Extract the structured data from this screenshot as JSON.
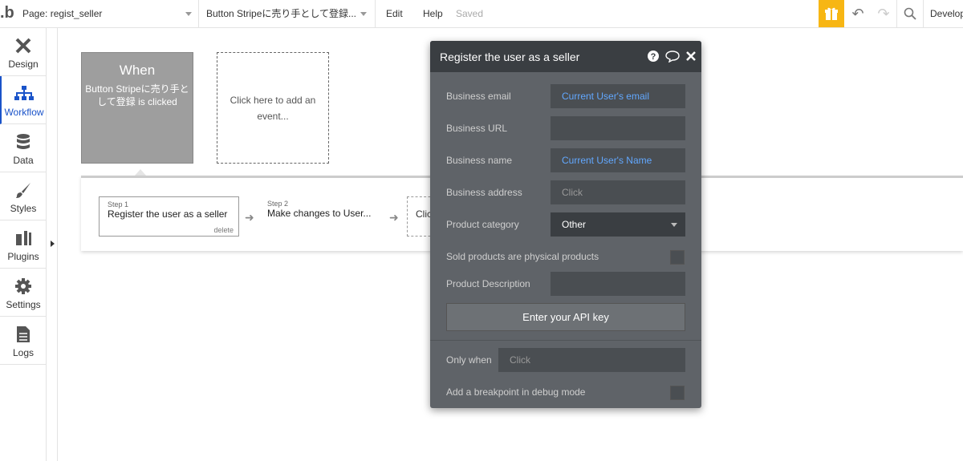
{
  "topbar": {
    "logo": ".b",
    "page_select": "Page: regist_seller",
    "element_select": "Button Stripeに売り手として登録...",
    "edit": "Edit",
    "help": "Help",
    "saved": "Saved",
    "develop": "Development",
    "gift_color": "#f7b614"
  },
  "sidebar": {
    "items": [
      {
        "label": "Design",
        "icon": "design-tools-icon"
      },
      {
        "label": "Workflow",
        "icon": "workflow-sitemap-icon"
      },
      {
        "label": "Data",
        "icon": "database-icon"
      },
      {
        "label": "Styles",
        "icon": "paintbrush-icon"
      },
      {
        "label": "Plugins",
        "icon": "plug-icon"
      },
      {
        "label": "Settings",
        "icon": "gear-icon"
      },
      {
        "label": "Logs",
        "icon": "document-icon"
      }
    ],
    "active_color": "#1a53c9"
  },
  "canvas": {
    "when_title": "When",
    "when_desc": "Button Stripeに売り手として登録 is clicked",
    "add_event": "Click here to add an event...",
    "steps": [
      {
        "num": "Step 1",
        "title": "Register the user as a seller",
        "delete": "delete"
      },
      {
        "num": "Step 2",
        "title": "Make changes to User..."
      },
      {
        "title": "Clic"
      }
    ]
  },
  "panel": {
    "title": "Register the user as a seller",
    "fields": {
      "business_email": {
        "label": "Business email",
        "value": "Current User's email"
      },
      "business_url": {
        "label": "Business URL",
        "value": ""
      },
      "business_name": {
        "label": "Business name",
        "value": "Current User's Name"
      },
      "business_address": {
        "label": "Business address",
        "value": "Click"
      },
      "product_category": {
        "label": "Product category",
        "value": "Other"
      },
      "sold_physical": {
        "label": "Sold products are physical products"
      },
      "product_description": {
        "label": "Product Description",
        "value": ""
      }
    },
    "api_button": "Enter your API key",
    "only_when": {
      "label": "Only when",
      "value": "Click"
    },
    "breakpoint": {
      "label": "Add a breakpoint in debug mode"
    }
  }
}
